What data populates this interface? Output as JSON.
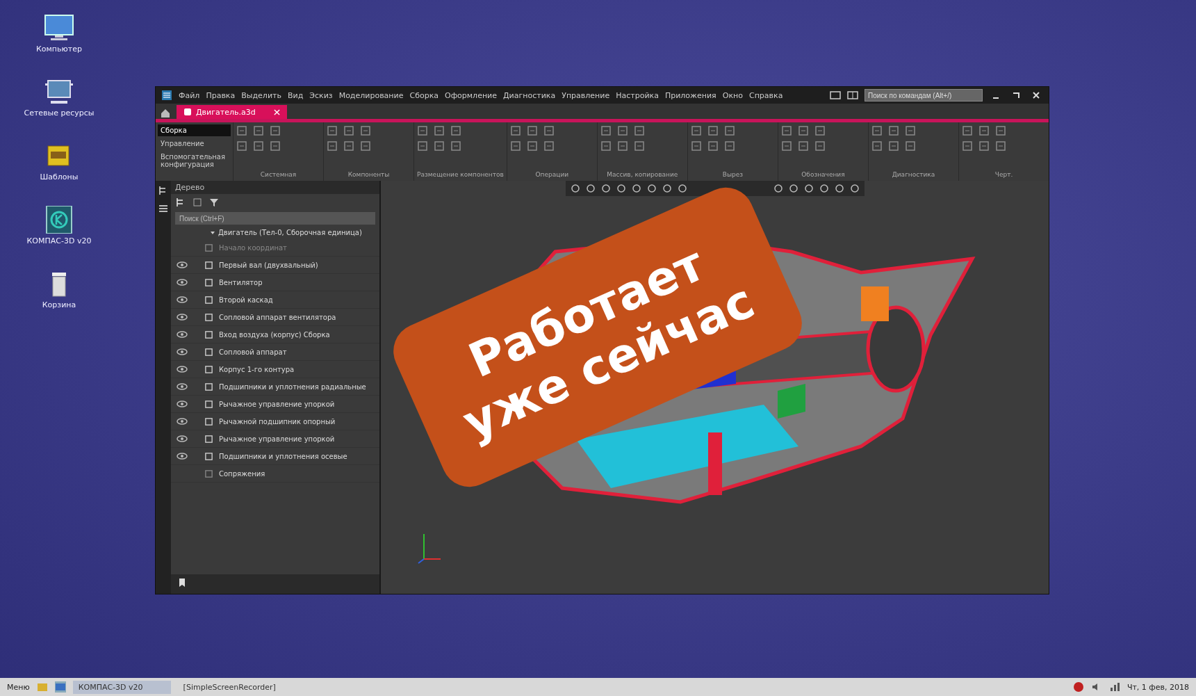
{
  "desktop_icons": [
    {
      "label": "Компьютер",
      "kind": "computer"
    },
    {
      "label": "Сетевые ресурсы",
      "kind": "network"
    },
    {
      "label": "Шаблоны",
      "kind": "folder"
    },
    {
      "label": "КОМПАС-3D v20",
      "kind": "kompas"
    },
    {
      "label": "Корзина",
      "kind": "trash"
    }
  ],
  "window": {
    "menu": [
      "Файл",
      "Правка",
      "Выделить",
      "Вид",
      "Эскиз",
      "Моделирование",
      "Сборка",
      "Оформление",
      "Диагностика",
      "Управление",
      "Настройка",
      "Приложения",
      "Окно",
      "Справка"
    ],
    "search": {
      "placeholder": "Поиск по командам (Alt+/)"
    },
    "tabs": [
      {
        "label": "Двигатель.a3d",
        "selected": true
      }
    ],
    "ribbon": {
      "modes": [
        {
          "label": "Сборка",
          "selected": true
        },
        {
          "label": "Управление",
          "selected": false
        },
        {
          "label": "Вспомогательная конфигурация",
          "selected": false
        }
      ],
      "groups": [
        "Системная",
        "Компоненты",
        "Размещение компонентов",
        "Операции",
        "Массив, копирование",
        "Вырез",
        "Обозначения",
        "Диагностика",
        "Черт."
      ]
    },
    "tree": {
      "title": "Дерево",
      "search": {
        "placeholder": "Поиск (Ctrl+F)"
      },
      "root": {
        "label": "Двигатель (Тел-0, Сборочная единица)",
        "expanded": true,
        "children": [
          {
            "label": "Начало координат",
            "kind": "origin"
          },
          {
            "label": "Первый вал (двухвальный)",
            "kind": "part"
          },
          {
            "label": "Вентилятор",
            "kind": "part"
          },
          {
            "label": "Второй каскад",
            "kind": "part"
          },
          {
            "label": "Сопловой аппарат вентилятора",
            "kind": "part"
          },
          {
            "label": "Вход воздуха (корпус) Сборка",
            "kind": "part"
          },
          {
            "label": "Сопловой аппарат",
            "kind": "part"
          },
          {
            "label": "Корпус 1-го контура",
            "kind": "part"
          },
          {
            "label": "Подшипники и уплотнения радиальные",
            "kind": "part"
          },
          {
            "label": "Рычажное управление упоркой",
            "kind": "part"
          },
          {
            "label": "Рычажной подшипник опорный",
            "kind": "part"
          },
          {
            "label": "Рычажное управление упоркой",
            "kind": "part"
          },
          {
            "label": "Подшипники и уплотнения осевые",
            "kind": "part"
          },
          {
            "label": "Сопряжения",
            "kind": "mates"
          }
        ]
      }
    }
  },
  "banner": {
    "lines": [
      "Работает",
      "уже сейчас"
    ]
  },
  "taskbar": {
    "start": "Меню",
    "tasks": [
      {
        "label": "КОМПАС-3D v20",
        "selected": true
      },
      {
        "label": "[SimpleScreenRecorder]",
        "selected": false
      }
    ],
    "clock": "Чт, 1 фев, 2018"
  }
}
